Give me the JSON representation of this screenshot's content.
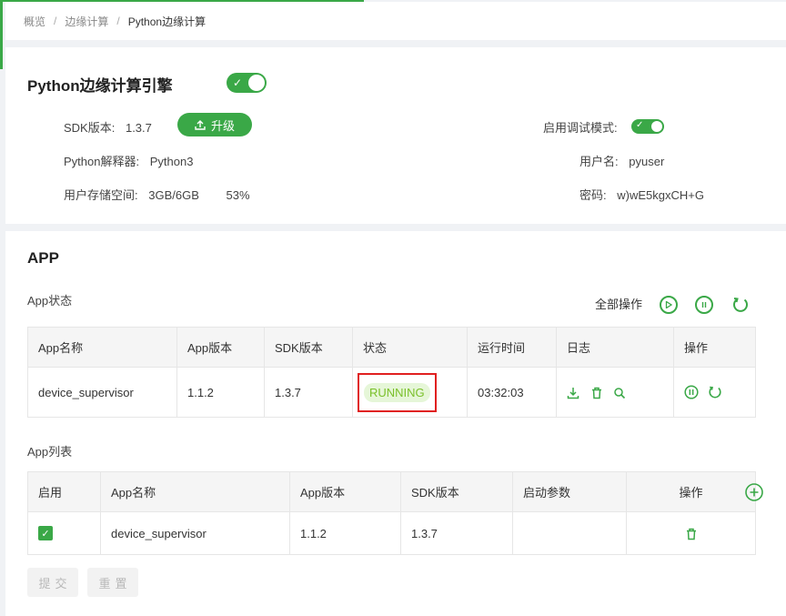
{
  "breadcrumb": {
    "items": [
      "概览",
      "边缘计算",
      "Python边缘计算"
    ],
    "separator": "/"
  },
  "engine": {
    "title": "Python边缘计算引擎",
    "enabled": true,
    "sdk_label": "SDK版本:",
    "sdk_value": "1.3.7",
    "upgrade_label": "升级",
    "interpreter_label": "Python解释器:",
    "interpreter_value": "Python3",
    "storage_label": "用户存储空间:",
    "storage_value": "3GB/6GB",
    "storage_percent": "53%",
    "debug_label": "启用调试模式:",
    "debug_enabled": true,
    "username_label": "用户名:",
    "username_value": "pyuser",
    "password_label": "密码:",
    "password_value": "w)wE5kgxCH+G"
  },
  "app": {
    "title": "APP",
    "status_title": "App状态",
    "all_ops_label": "全部操作",
    "status_table": {
      "headers": [
        "App名称",
        "App版本",
        "SDK版本",
        "状态",
        "运行时间",
        "日志",
        "操作"
      ],
      "row": {
        "name": "device_supervisor",
        "app_version": "1.1.2",
        "sdk_version": "1.3.7",
        "status": "RUNNING",
        "runtime": "03:32:03"
      }
    },
    "list_title": "App列表",
    "list_table": {
      "headers": [
        "启用",
        "App名称",
        "App版本",
        "SDK版本",
        "启动参数",
        "操作"
      ],
      "row": {
        "enabled": true,
        "name": "device_supervisor",
        "app_version": "1.1.2",
        "sdk_version": "1.3.7",
        "params": ""
      }
    },
    "submit_label": "提交",
    "reset_label": "重置"
  },
  "colors": {
    "accent": "#3aa847",
    "status_bg": "#e6f6d8",
    "status_text": "#7ac02a",
    "highlight_border": "#e02020"
  },
  "icons": [
    "upload-icon",
    "play-icon",
    "pause-icon",
    "refresh-icon",
    "download-icon",
    "trash-icon",
    "search-icon",
    "plus-icon",
    "check-icon"
  ]
}
